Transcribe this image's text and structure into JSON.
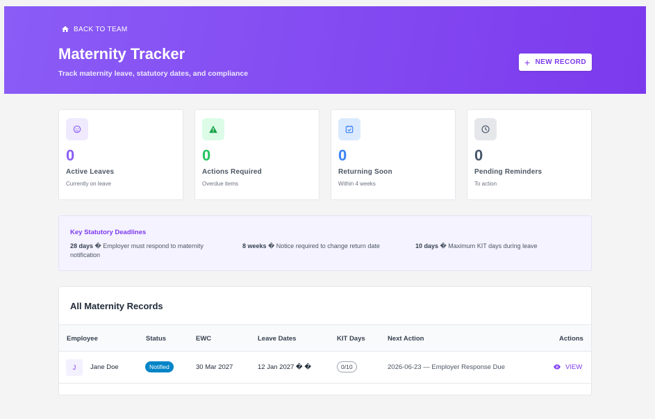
{
  "header": {
    "back_label": "BACK TO TEAM",
    "title": "Maternity Tracker",
    "subtitle": "Track maternity leave, statutory dates, and compliance",
    "new_record_label": "NEW RECORD"
  },
  "stats": [
    {
      "value": "0",
      "label": "Active Leaves",
      "sub": "Currently on leave",
      "icon": "baby-face-icon",
      "color": "#8b5cf6",
      "bg": "#efeafe"
    },
    {
      "value": "0",
      "label": "Actions Required",
      "sub": "Overdue items",
      "icon": "warning-icon",
      "color": "#22c55e",
      "bg": "#dcfce7"
    },
    {
      "value": "0",
      "label": "Returning Soon",
      "sub": "Within 4 weeks",
      "icon": "calendar-check-icon",
      "color": "#3b82f6",
      "bg": "#dbeafe"
    },
    {
      "value": "0",
      "label": "Pending Reminders",
      "sub": "To action",
      "icon": "clock-icon",
      "color": "#64748b",
      "bg": "#e5e7eb"
    }
  ],
  "deadlines": {
    "title": "Key Statutory Deadlines",
    "items": [
      {
        "bold": "28 days",
        "text": " � Employer must respond to maternity notification"
      },
      {
        "bold": "8 weeks",
        "text": " � Notice required to change return date"
      },
      {
        "bold": "10 days",
        "text": " � Maximum KIT days during leave"
      }
    ]
  },
  "records": {
    "title": "All Maternity Records",
    "columns": [
      "Employee",
      "Status",
      "EWC",
      "Leave Dates",
      "KIT Days",
      "Next Action",
      "Actions"
    ],
    "rows": [
      {
        "initial": "J",
        "employee": "Jane Doe",
        "status": "Notified",
        "ewc": "30 Mar 2027",
        "leave_dates": "12 Jan 2027 � �",
        "kit_days": "0/10",
        "next_action": "2026-06-23 — Employer Response Due",
        "action": "VIEW"
      }
    ]
  }
}
